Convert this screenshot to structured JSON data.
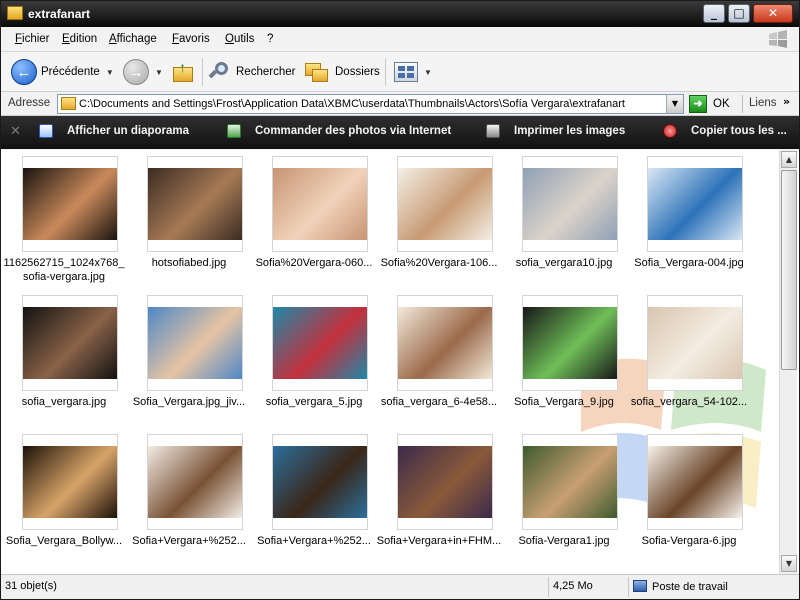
{
  "window": {
    "title": "extrafanart"
  },
  "titlebar": {
    "min": "_",
    "max": "□",
    "close": "✕"
  },
  "menu": [
    "Fichier",
    "Edition",
    "Affichage",
    "Favoris",
    "Outils",
    "?"
  ],
  "toolbar": {
    "back": "Précédente",
    "search": "Rechercher",
    "folders": "Dossiers"
  },
  "address": {
    "label": "Adresse",
    "path": "C:\\Documents and Settings\\Frost\\Application Data\\XBMC\\userdata\\Thumbnails\\Actors\\Sofía Vergara\\extrafanart",
    "go": "OK",
    "links": "Liens"
  },
  "tasks": [
    {
      "label": "Afficher un diaporama",
      "icon": "slideshow-icon"
    },
    {
      "label": "Commander des photos via Internet",
      "icon": "order-prints-icon"
    },
    {
      "label": "Imprimer les images",
      "icon": "printer-icon"
    },
    {
      "label": "Copier tous les ...",
      "icon": "copy-cd-icon"
    }
  ],
  "files": [
    {
      "name": "1162562715_1024x768_\nsofia-vergara.jpg",
      "colors": [
        "#1a1410",
        "#c98a5a"
      ]
    },
    {
      "name": "hotsofiabed.jpg",
      "colors": [
        "#3a2c22",
        "#a77a55"
      ]
    },
    {
      "name": "Sofia%20Vergara-060...",
      "colors": [
        "#c79474",
        "#f1d2b9"
      ]
    },
    {
      "name": "Sofia%20Vergara-106...",
      "colors": [
        "#f4efe6",
        "#c79a72"
      ]
    },
    {
      "name": "sofia_vergara10.jpg",
      "colors": [
        "#8fa0b6",
        "#dbd3c8"
      ]
    },
    {
      "name": "Sofia_Vergara-004.jpg",
      "colors": [
        "#d9e7f5",
        "#2d73b8"
      ]
    },
    {
      "name": "sofia_vergara.jpg",
      "colors": [
        "#121212",
        "#8a6248"
      ]
    },
    {
      "name": "Sofia_Vergara.jpg_jiv...",
      "colors": [
        "#4f87c6",
        "#e6c5a4"
      ]
    },
    {
      "name": "sofia_vergara_5.jpg",
      "colors": [
        "#1f88a8",
        "#c4303c"
      ]
    },
    {
      "name": "sofia_vergara_6-4e58...",
      "colors": [
        "#f3e9da",
        "#9a6a4a"
      ]
    },
    {
      "name": "Sofia_Vergara_9.jpg",
      "colors": [
        "#181818",
        "#6fbf58"
      ]
    },
    {
      "name": "sofia_vergara_54-102...",
      "colors": [
        "#d8c6b0",
        "#f4ece2"
      ]
    },
    {
      "name": "Sofia_Vergara_Bollyw...",
      "colors": [
        "#1c1208",
        "#d8a468"
      ]
    },
    {
      "name": "Sofia+Vergara+%252...",
      "colors": [
        "#f2ece4",
        "#7a5236"
      ]
    },
    {
      "name": "Sofia+Vergara+%252...",
      "colors": [
        "#2c6f9c",
        "#3a2618"
      ]
    },
    {
      "name": "Sofia+Vergara+in+FHM...",
      "colors": [
        "#3c2a4a",
        "#8a5a3a"
      ]
    },
    {
      "name": "Sofia-Vergara1.jpg",
      "colors": [
        "#3e5a2e",
        "#c9a073"
      ]
    },
    {
      "name": "Sofia-Vergara-6.jpg",
      "colors": [
        "#f6f2ea",
        "#6a4428"
      ]
    }
  ],
  "status": {
    "count": "31 objet(s)",
    "size": "4,25 Mo",
    "location": "Poste de travail"
  }
}
